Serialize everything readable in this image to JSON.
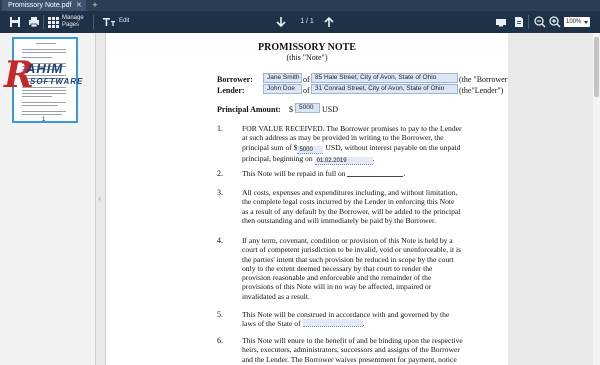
{
  "tabs": [
    {
      "label": "Promissory Note.pdf",
      "close": "✕"
    }
  ],
  "tab_add": "+",
  "toolbar": {
    "manage_pages_line1": "Manage",
    "manage_pages_line2": "Pages",
    "edit_label": "Edit",
    "page_indicator": "1 / 1",
    "zoom": "100%"
  },
  "sidebar": {
    "thumbnail_page_number": "1"
  },
  "watermark": {
    "name": "AHIM",
    "sub": "SOFTWARE"
  },
  "document": {
    "title": "PROMISSORY NOTE",
    "subtitle": "(this \"Note\")",
    "borrower_label": "Borrower:",
    "lender_label": "Lender:",
    "borrower_name": "Jane Smith",
    "borrower_address": "85 Hale Street, City of Avon, State of Ohio",
    "lender_name": "John Doe",
    "lender_address": "31 Conrad Street, City of Avon, State of Ohio",
    "of": "of",
    "borrower_alias": "(the \"Borrower\")",
    "lender_alias": "(the\"Lender\")",
    "principal_label": "Principal Amount:",
    "currency_symbol": "$",
    "principal_amount": "5000",
    "currency": "USD",
    "p1_num": "1.",
    "p1_a": "FOR VALUE RECEIVED. The Borrower promises to pay to the Lender",
    "p1_b": "at such address as may be provided in writing to the Borrower, the",
    "p1_c_pre": "principal sum of $",
    "p1_amount": "5000",
    "p1_c_post": "USD, without interest payable on the unpaid",
    "p1_d_pre": "principal, beginning on",
    "p1_date": "01.02.2019",
    "p1_d_post": ".",
    "p2_num": "2.",
    "p2_pre": "This Note will be repaid in full on",
    "p2_post": ".",
    "p3_num": "3.",
    "p3_lines": [
      "All costs, expenses and expenditures including, and without limitation,",
      "the complete legal costs incurred by the Lender in enforcing this Note",
      "as a result of any default by the Borrower, will be added to the principal",
      "then outstanding and will immediately be paid by the Borrower."
    ],
    "p4_num": "4.",
    "p4_lines": [
      "If any term, covenant, condition or provision of this Note is held by a",
      "court of competent jurisdiction to be invalid, void or unenforceable, it is",
      "the parties' intent that such provision be reduced in scope by the court",
      "only to the extent deemed necessary by that court to render the",
      "provision reasonable and enforceable and the remainder of the",
      "provisions of this Note will in no way be affected, impaired or",
      "invalidated as a result."
    ],
    "p5_num": "5.",
    "p5_a": "This Note will be construed in accordance with and governed by the",
    "p5_b_pre": "laws of the State of",
    "p5_b_post": ".",
    "p6_num": "6.",
    "p6_lines": [
      "This Note will enure to the benefit of and be binding upon the respective",
      "heirs, executors, administrators, successors and assigns of the Borrower",
      "and the Lender. The Borrower waives presentment for payment, notice"
    ]
  }
}
